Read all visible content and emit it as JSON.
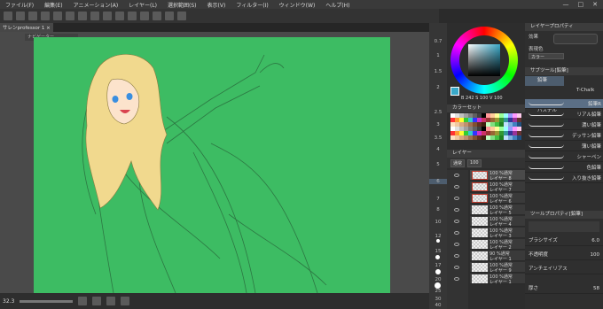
{
  "menubar": {
    "items": [
      "ファイル(F)",
      "編集(E)",
      "アニメーション(A)",
      "レイヤー(L)",
      "選択範囲(S)",
      "表示(V)",
      "フィルター(I)",
      "ウィンドウ(W)",
      "ヘルプ(H)"
    ],
    "controls": [
      "—",
      "□",
      "✕"
    ]
  },
  "document": {
    "tab_label": "サレンprofessor 1 ×",
    "navigator_tab": "ナビゲーター"
  },
  "status": {
    "zoom": "32.3"
  },
  "ruler": {
    "ticks": [
      "0.7",
      "1",
      "1.5",
      "2",
      "2.5",
      "3",
      "3.5",
      "4",
      "5",
      "6",
      "7",
      "8",
      "10",
      "12",
      "15",
      "17",
      "20",
      "25",
      "30",
      "40"
    ]
  },
  "color": {
    "readout": "B 242  S 100  V 100"
  },
  "panels": {
    "color_set": "カラーセット",
    "layer": "レイヤー",
    "layer_property": "レイヤープロパティ",
    "sub_tool": "サブツール[鉛筆]",
    "tool_property": "ツールプロパティ[鉛筆]"
  },
  "layer_panel": {
    "blend": "通常",
    "opacity": "100"
  },
  "layers": [
    {
      "pct": "100 %通常",
      "name": "レイヤー 8"
    },
    {
      "pct": "100 %通常",
      "name": "レイヤー 7"
    },
    {
      "pct": "100 %通常",
      "name": "レイヤー 6"
    },
    {
      "pct": "100 %通常",
      "name": "レイヤー 5"
    },
    {
      "pct": "100 %通常",
      "name": "レイヤー 4"
    },
    {
      "pct": "100 %通常",
      "name": "レイヤー 3"
    },
    {
      "pct": "100 %通常",
      "name": "レイヤー 2"
    },
    {
      "pct": "90 %通常",
      "name": "レイヤー 1"
    },
    {
      "pct": "100 %通常",
      "name": "レイヤー 9"
    },
    {
      "pct": "100 %通常",
      "name": "レイヤー 1"
    }
  ],
  "layer_property": {
    "effect_label": "効果",
    "expr_label": "表現色",
    "expr_value": "カラー"
  },
  "brush": {
    "tabs": [
      {
        "label": "鉛筆"
      },
      {
        "label": "T-Chalk"
      },
      {
        "label": "パステル"
      }
    ],
    "items": [
      "鉛筆R",
      "リアル鉛筆",
      "濃い鉛筆",
      "デッサン鉛筆",
      "薄い鉛筆",
      "シャーペン",
      "色鉛筆",
      "入り抜き鉛筆"
    ]
  },
  "tool_property": {
    "brush_size_label": "ブラシサイズ",
    "brush_size": "6.0",
    "opacity_label": "不透明度",
    "opacity": "100",
    "aa_label": "アンチエイリアス",
    "thickness_label": "厚さ",
    "thickness": "58"
  },
  "colors": {
    "canvas_bg": "#3dbc63",
    "selected_brush": "#5b6f86",
    "accent": "#4d5d6e"
  }
}
